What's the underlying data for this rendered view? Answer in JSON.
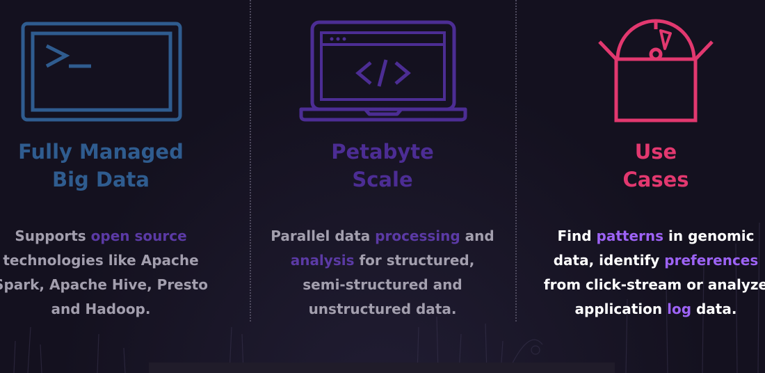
{
  "colors": {
    "background": "#14111f",
    "blue": "#2f5c8f",
    "purple": "#4c2d94",
    "pink": "#e2386f",
    "highlight_dim": "#5b3aa5",
    "highlight_bright": "#9d63f5",
    "text_grey": "#a39fae"
  },
  "features": [
    {
      "icon": "terminal-icon",
      "title": [
        "Fully Managed",
        "Big Data"
      ],
      "desc": [
        {
          "t": "Supports "
        },
        {
          "t": "open source",
          "hl": true
        },
        {
          "t": " technologies like Apache Spark, Apache Hive, Presto and Hadoop."
        }
      ]
    },
    {
      "icon": "laptop-code-icon",
      "title": [
        "Petabyte",
        "Scale"
      ],
      "desc": [
        {
          "t": "Parallel data "
        },
        {
          "t": "processing",
          "hl": true
        },
        {
          "t": " and "
        },
        {
          "t": "analysis",
          "hl": true
        },
        {
          "t": " for structured, semi-structured and unstructured data."
        }
      ]
    },
    {
      "icon": "open-box-disc-icon",
      "title": [
        "Use",
        "Cases"
      ],
      "desc": [
        {
          "t": "Find "
        },
        {
          "t": "patterns",
          "hl": true
        },
        {
          "t": " in genomic data, identify "
        },
        {
          "t": "preferences",
          "hl": true
        },
        {
          "t": " from click-stream or analyze application "
        },
        {
          "t": "log",
          "hl": true
        },
        {
          "t": " data."
        }
      ]
    }
  ]
}
